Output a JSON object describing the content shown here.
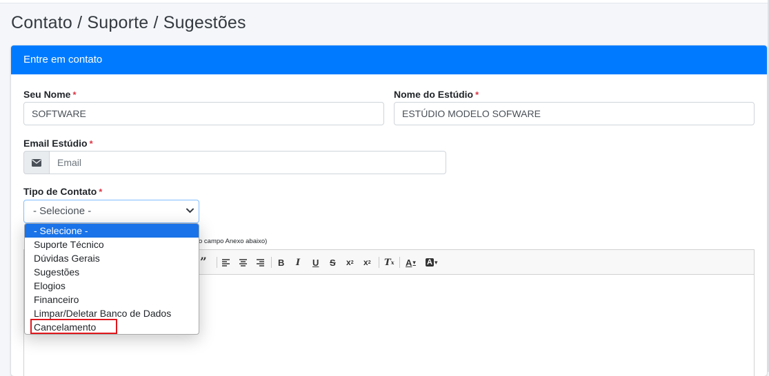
{
  "page": {
    "title": "Contato / Suporte / Sugestões"
  },
  "card": {
    "header": "Entre em contato"
  },
  "form": {
    "name": {
      "label": "Seu Nome",
      "value": "SOFTWARE"
    },
    "studio": {
      "label": "Nome do Estúdio",
      "value": "ESTÚDIO MODELO SOFWARE"
    },
    "email": {
      "label": "Email Estúdio",
      "placeholder": "Email"
    },
    "contact_type": {
      "label": "Tipo de Contato",
      "selected": "- Selecione -",
      "options": [
        "- Selecione -",
        "Suporte Técnico",
        "Dúvidas Gerais",
        "Sugestões",
        "Elogios",
        "Financeiro",
        "Limpar/Deletar Banco de Dados",
        "Cancelamento"
      ]
    },
    "required_mark": "*",
    "hint": "o campo Anexo abaixo)"
  },
  "colors": {
    "header_bg": "#007bff",
    "selected_option_bg": "#1a73e8",
    "required": "#dc3545",
    "highlight_box": "#e0161b"
  },
  "icons": {
    "email_addon": "envelope-icon",
    "select_arrow": "chevron-down-icon"
  }
}
